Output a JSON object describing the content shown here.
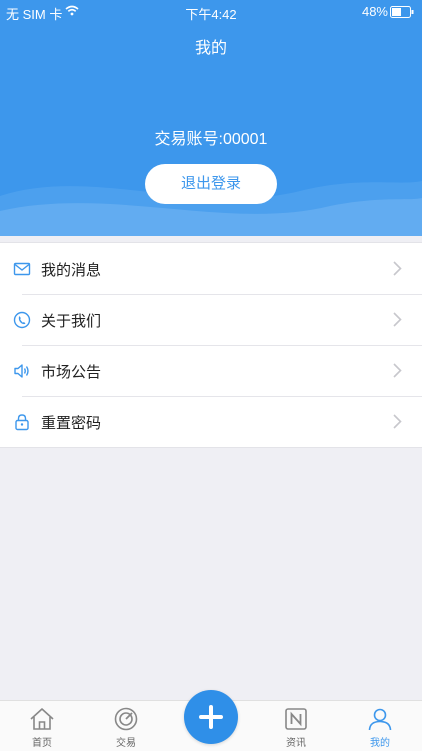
{
  "status_bar": {
    "carrier": "无 SIM 卡",
    "time": "下午4:42",
    "battery": "48%"
  },
  "header": {
    "title": "我的",
    "account_label": "交易账号:00001",
    "logout_label": "退出登录"
  },
  "menu": {
    "items": [
      {
        "label": "我的消息",
        "icon": "mail-icon"
      },
      {
        "label": "关于我们",
        "icon": "phone-icon"
      },
      {
        "label": "市场公告",
        "icon": "speaker-icon"
      },
      {
        "label": "重置密码",
        "icon": "lock-icon"
      }
    ]
  },
  "tabbar": {
    "tabs": [
      {
        "label": "首页",
        "icon": "home-icon"
      },
      {
        "label": "交易",
        "icon": "trade-icon"
      },
      {
        "label": "资讯",
        "icon": "news-icon"
      },
      {
        "label": "我的",
        "icon": "user-icon",
        "active": true
      }
    ]
  },
  "colors": {
    "primary": "#3d97ec",
    "background": "#efeff4"
  }
}
